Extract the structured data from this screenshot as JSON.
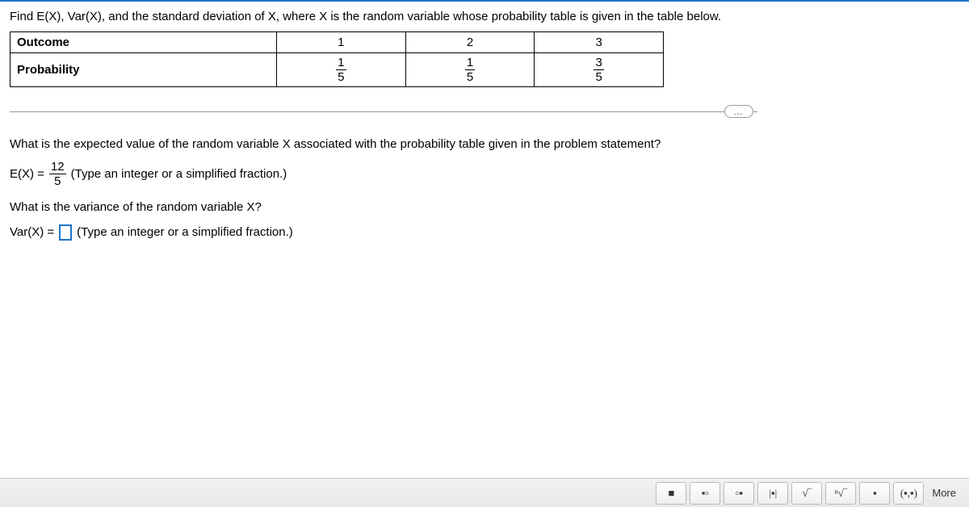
{
  "problem": "Find E(X), Var(X), and the standard deviation of X, where X is the random variable whose probability table is given in the table below.",
  "table": {
    "row1_label": "Outcome",
    "row2_label": "Probability",
    "outcomes": [
      "1",
      "2",
      "3"
    ],
    "probs": [
      {
        "num": "1",
        "den": "5"
      },
      {
        "num": "1",
        "den": "5"
      },
      {
        "num": "3",
        "den": "5"
      }
    ]
  },
  "ellipsis": "…",
  "q1": "What is the expected value of the random variable X associated with the probability table given in the problem statement?",
  "ex_label": "E(X)  =",
  "ex_answer": {
    "num": "12",
    "den": "5"
  },
  "hint1": "(Type an integer or a simplified fraction.)",
  "q2": "What is the variance of the random variable X?",
  "var_label": "Var(X)   =",
  "hint2": "(Type an integer or a simplified fraction.)",
  "toolbar": {
    "t1": "■",
    "t2": "▪▫",
    "t3": "▫▪",
    "t4": "|▪|",
    "t5": "√‾",
    "t6": "ⁿ√‾",
    "t7": "▪",
    "t8": "(▪,▪)",
    "more": "More"
  }
}
